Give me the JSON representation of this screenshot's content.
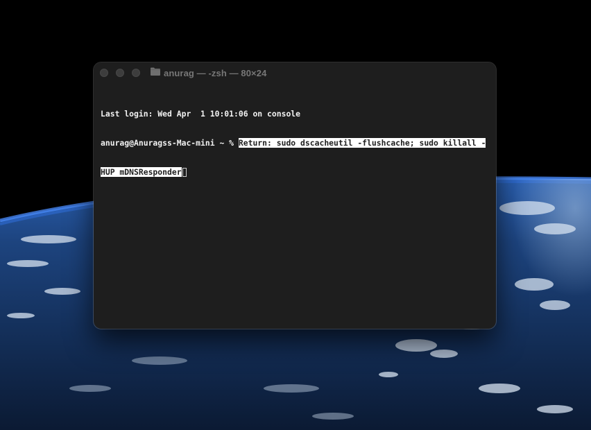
{
  "window": {
    "title": "anurag — -zsh — 80×24"
  },
  "terminal": {
    "last_login": "Last login: Wed Apr  1 10:01:06 on console",
    "prompt": "anurag@Anuragss-Mac-mini ~ % ",
    "selected_line1": "Return: sudo dscacheutil -flushcache; sudo killall -",
    "selected_line2": "HUP mDNSResponder"
  },
  "icons": {
    "close": "close-icon",
    "minimize": "minimize-icon",
    "zoom": "zoom-icon",
    "folder": "folder-icon"
  },
  "colors": {
    "terminal_bg": "#1e1e1e",
    "text": "#f2f2f2",
    "selection": "#ffffff",
    "title": "#777777"
  }
}
